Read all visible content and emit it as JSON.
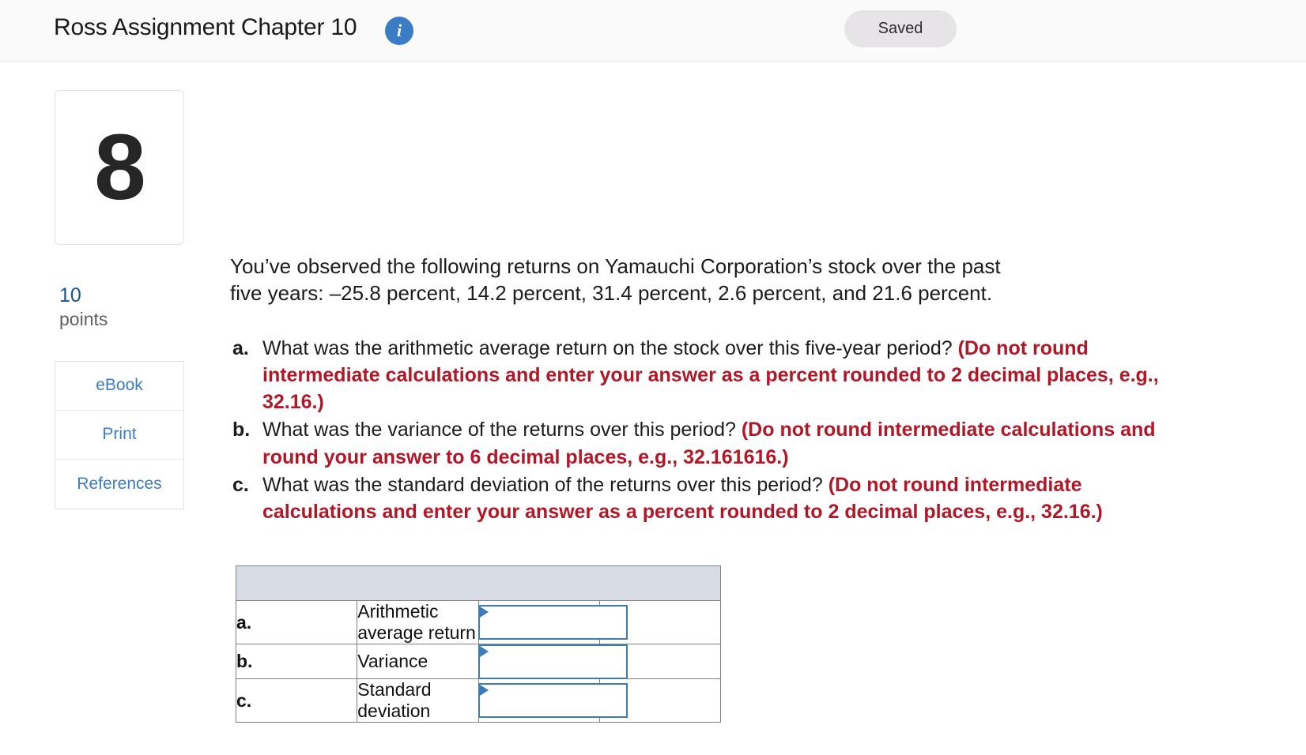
{
  "topbar": {
    "assignment_title": "Ross Assignment Chapter 10",
    "info_icon_glyph": "i",
    "info_icon_name": "info-icon",
    "saved_label": "Saved",
    "saved_badge_color": "#e6e4e6",
    "info_icon_color": "#3b7cc4"
  },
  "left_rail": {
    "question_number": "8",
    "points_value": "10",
    "points_label": "points",
    "points_value_color": "#17548c",
    "actions": [
      {
        "label": "eBook"
      },
      {
        "label": "Print"
      },
      {
        "label": "References"
      }
    ],
    "action_link_color": "#3d7cc0"
  },
  "question": {
    "stem_line_1": "You’ve observed the following returns on Yamauchi Corporation’s stock over the past",
    "stem_line_2": "five years: –25.8 percent, 14.2 percent, 31.4 percent, 2.6 percent, and 21.6 percent.",
    "returns": [
      "-25.8",
      "14.2",
      "31.4",
      "2.6",
      "21.6"
    ],
    "returns_unit": "percent",
    "years": 5,
    "hint_color": "#b01827",
    "parts": [
      {
        "letter": "a.",
        "text": "What was the arithmetic average return on the stock over this five-year period? ",
        "hint": "(Do not round intermediate calculations and enter your answer as a percent rounded to 2 decimal places, e.g., 32.16.)"
      },
      {
        "letter": "b.",
        "text": "What was the variance of the returns over this period? ",
        "hint": "(Do not round intermediate calculations and round your answer to 6 decimal places, e.g., 32.161616.)"
      },
      {
        "letter": "c.",
        "text": "What was the standard deviation of the returns over this period? ",
        "hint": "(Do not round intermediate calculations and enter your answer as a percent rounded to 2 decimal places, e.g., 32.16.)"
      }
    ]
  },
  "answer_table": {
    "header_fill": "#d8dce5",
    "header_label": "",
    "rows": [
      {
        "letter": "a.",
        "label": "Arithmetic average return",
        "value": "",
        "unit": "%"
      },
      {
        "letter": "b.",
        "label": "Variance",
        "value": "",
        "unit": ""
      },
      {
        "letter": "c.",
        "label": "Standard deviation",
        "value": "",
        "unit": "%"
      }
    ]
  }
}
